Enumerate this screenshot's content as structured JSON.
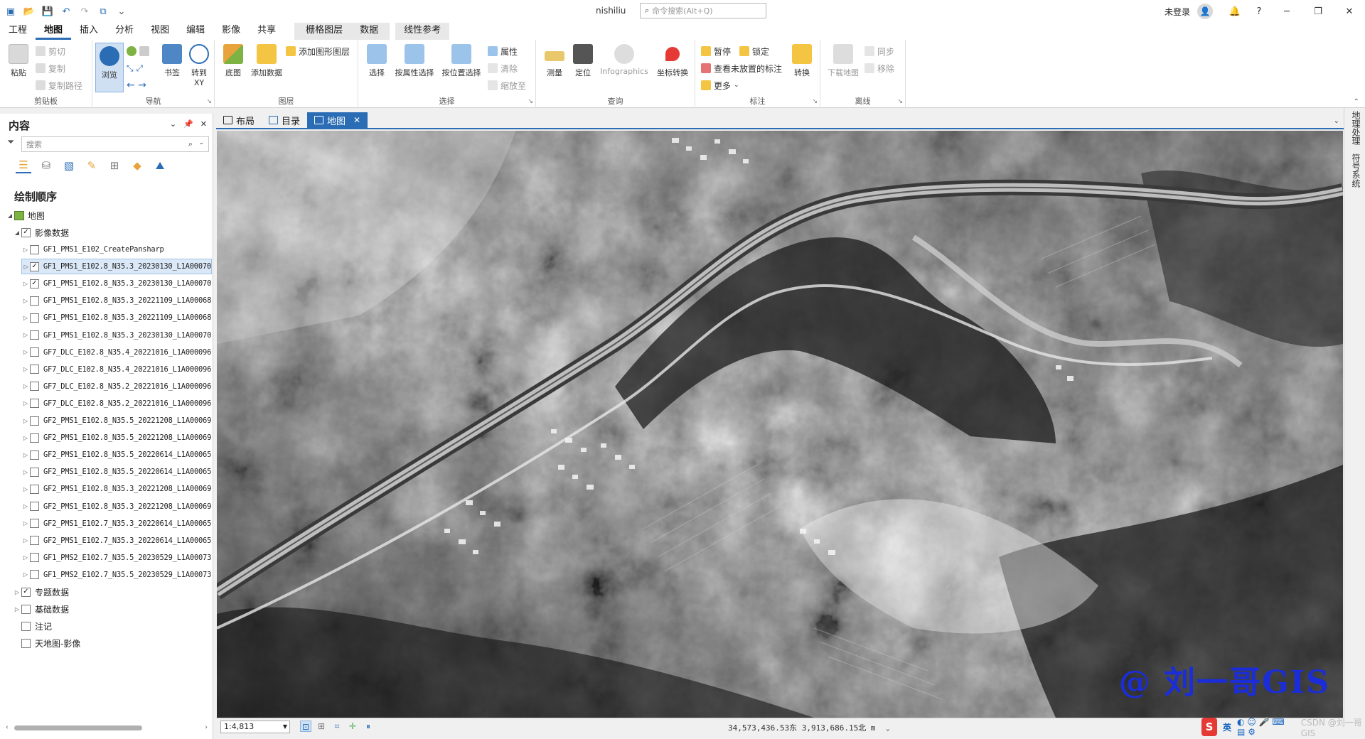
{
  "title_bar": {
    "project_name": "nishiliu",
    "command_search_placeholder": "命令搜索(Alt+Q)",
    "user_status": "未登录",
    "help_label": "?"
  },
  "ribbon_tabs": [
    "工程",
    "地图",
    "插入",
    "分析",
    "视图",
    "编辑",
    "影像",
    "共享"
  ],
  "context_tabs": [
    "栅格图层",
    "数据"
  ],
  "context_tab_2": "线性参考",
  "ribbon": {
    "clipboard": {
      "label": "剪贴板",
      "paste": "粘贴",
      "cut": "剪切",
      "copy": "复制",
      "copy_path": "复制路径"
    },
    "navigate": {
      "label": "导航",
      "explore": "浏览",
      "bookmarks": "书签",
      "goto_xy_line1": "转到",
      "goto_xy_line2": "XY"
    },
    "layer": {
      "label": "图层",
      "basemap": "底图",
      "add_data": "添加数据",
      "add_graphics_layer": "添加图形图层"
    },
    "selection": {
      "label": "选择",
      "select": "选择",
      "select_by_attributes": "按属性选择",
      "select_by_location": "按位置选择",
      "attributes": "属性",
      "clear": "清除",
      "zoom_to": "缩放至"
    },
    "inquiry": {
      "label": "查询",
      "measure": "测量",
      "locate": "定位",
      "infographics": "Infographics",
      "convert_coordinates": "坐标转换"
    },
    "labeling": {
      "label": "标注",
      "pause": "暂停",
      "lock": "锁定",
      "view_unplaced": "查看未放置的标注",
      "more": "更多",
      "convert": "转换"
    },
    "offline": {
      "label": "离线",
      "download_map": "下载地图",
      "sync": "同步",
      "remove": "移除"
    }
  },
  "contents_pane": {
    "title": "内容",
    "search_placeholder": "搜索",
    "drawing_order_title": "绘制顺序",
    "map_name": "地图",
    "group_name": "影像数据",
    "layers": [
      {
        "name": "GF1_PMS1_E102_CreatePansharp",
        "checked": false,
        "selected": false
      },
      {
        "name": "GF1_PMS1_E102.8_N35.3_20230130_L1A00070",
        "checked": true,
        "selected": true
      },
      {
        "name": "GF1_PMS1_E102.8_N35.3_20230130_L1A00070",
        "checked": true,
        "selected": false
      },
      {
        "name": "GF1_PMS1_E102.8_N35.3_20221109_L1A00068",
        "checked": false,
        "selected": false
      },
      {
        "name": "GF1_PMS1_E102.8_N35.3_20221109_L1A00068",
        "checked": false,
        "selected": false
      },
      {
        "name": "GF1_PMS1_E102.8_N35.3_20230130_L1A00070",
        "checked": false,
        "selected": false
      },
      {
        "name": "GF7_DLC_E102.8_N35.4_20221016_L1A000096",
        "checked": false,
        "selected": false
      },
      {
        "name": "GF7_DLC_E102.8_N35.4_20221016_L1A000096",
        "checked": false,
        "selected": false
      },
      {
        "name": "GF7_DLC_E102.8_N35.2_20221016_L1A000096",
        "checked": false,
        "selected": false
      },
      {
        "name": "GF7_DLC_E102.8_N35.2_20221016_L1A000096",
        "checked": false,
        "selected": false
      },
      {
        "name": "GF2_PMS1_E102.8_N35.5_20221208_L1A00069",
        "checked": false,
        "selected": false
      },
      {
        "name": "GF2_PMS1_E102.8_N35.5_20221208_L1A00069",
        "checked": false,
        "selected": false
      },
      {
        "name": "GF2_PMS1_E102.8_N35.5_20220614_L1A00065",
        "checked": false,
        "selected": false
      },
      {
        "name": "GF2_PMS1_E102.8_N35.5_20220614_L1A00065",
        "checked": false,
        "selected": false
      },
      {
        "name": "GF2_PMS1_E102.8_N35.3_20221208_L1A00069",
        "checked": false,
        "selected": false
      },
      {
        "name": "GF2_PMS1_E102.8_N35.3_20221208_L1A00069",
        "checked": false,
        "selected": false
      },
      {
        "name": "GF2_PMS1_E102.7_N35.3_20220614_L1A00065",
        "checked": false,
        "selected": false
      },
      {
        "name": "GF2_PMS1_E102.7_N35.3_20220614_L1A00065",
        "checked": false,
        "selected": false
      },
      {
        "name": "GF1_PMS2_E102.7_N35.5_20230529_L1A00073",
        "checked": false,
        "selected": false
      },
      {
        "name": "GF1_PMS2_E102.7_N35.5_20230529_L1A00073",
        "checked": false,
        "selected": false
      }
    ],
    "other_groups": [
      {
        "name": "专题数据",
        "checked": true,
        "expandable": true
      },
      {
        "name": "基础数据",
        "checked": false,
        "expandable": true
      },
      {
        "name": "注记",
        "checked": false,
        "expandable": false
      },
      {
        "name": "天地图-影像",
        "checked": false,
        "expandable": false
      }
    ]
  },
  "view_tabs": [
    {
      "label": "布局",
      "active": false
    },
    {
      "label": "目录",
      "active": false
    },
    {
      "label": "地图",
      "active": true
    }
  ],
  "watermark": "@ 刘一哥GIS",
  "right_strip": [
    "地理处理",
    "符号系统"
  ],
  "status_bar": {
    "scale": "1:4,813",
    "coordinates": "34,573,436.53东  3,913,686.15北 m"
  },
  "ime": {
    "mode": "英",
    "corner_text": "CSDN @刘一哥GIS"
  },
  "colors": {
    "accent": "#2a6db5",
    "watermark": "#1a2dd8"
  }
}
